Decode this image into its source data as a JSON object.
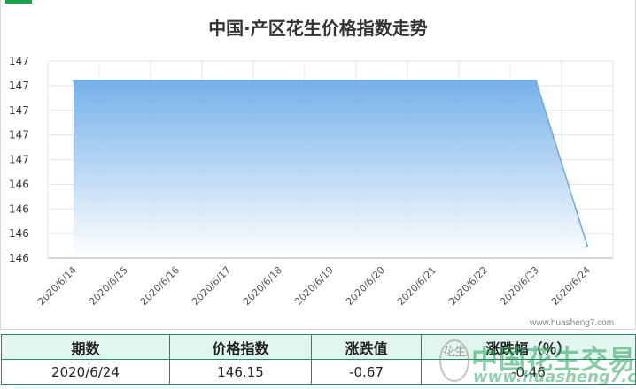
{
  "chart_data": {
    "type": "area",
    "title": "中国·产区花生价格指数走势",
    "xlabel": "",
    "ylabel": "",
    "categories": [
      "2020/6/14",
      "2020/6/15",
      "2020/6/16",
      "2020/6/17",
      "2020/6/18",
      "2020/6/19",
      "2020/6/20",
      "2020/6/21",
      "2020/6/22",
      "2020/6/23",
      "2020/6/24"
    ],
    "series": [
      {
        "values": [
          146.82,
          146.82,
          146.82,
          146.82,
          146.82,
          146.82,
          146.82,
          146.82,
          146.82,
          146.82,
          146.15
        ]
      }
    ],
    "ylim": [
      146.1,
      146.9
    ],
    "yticks": [
      "147",
      "147",
      "147",
      "147",
      "147",
      "146",
      "146",
      "146",
      "146"
    ],
    "grid": true,
    "legend": "none",
    "colors": {
      "area_top": "#6aaae8",
      "area_bottom": "#ffffff",
      "line": "#6aaae8",
      "grid": "#dfe5ec"
    }
  },
  "source_watermark": "www.huasheng7.com",
  "summary_table": {
    "headers": [
      "期数",
      "价格指数",
      "涨跌值",
      "涨跌幅（％）"
    ],
    "row": [
      "2020/6/24",
      "146.15",
      "-0.67",
      "-0.46"
    ]
  },
  "logo_watermark": {
    "seal": "花生",
    "name": "中国花生交易网",
    "url": "www.huasheng7.com"
  }
}
